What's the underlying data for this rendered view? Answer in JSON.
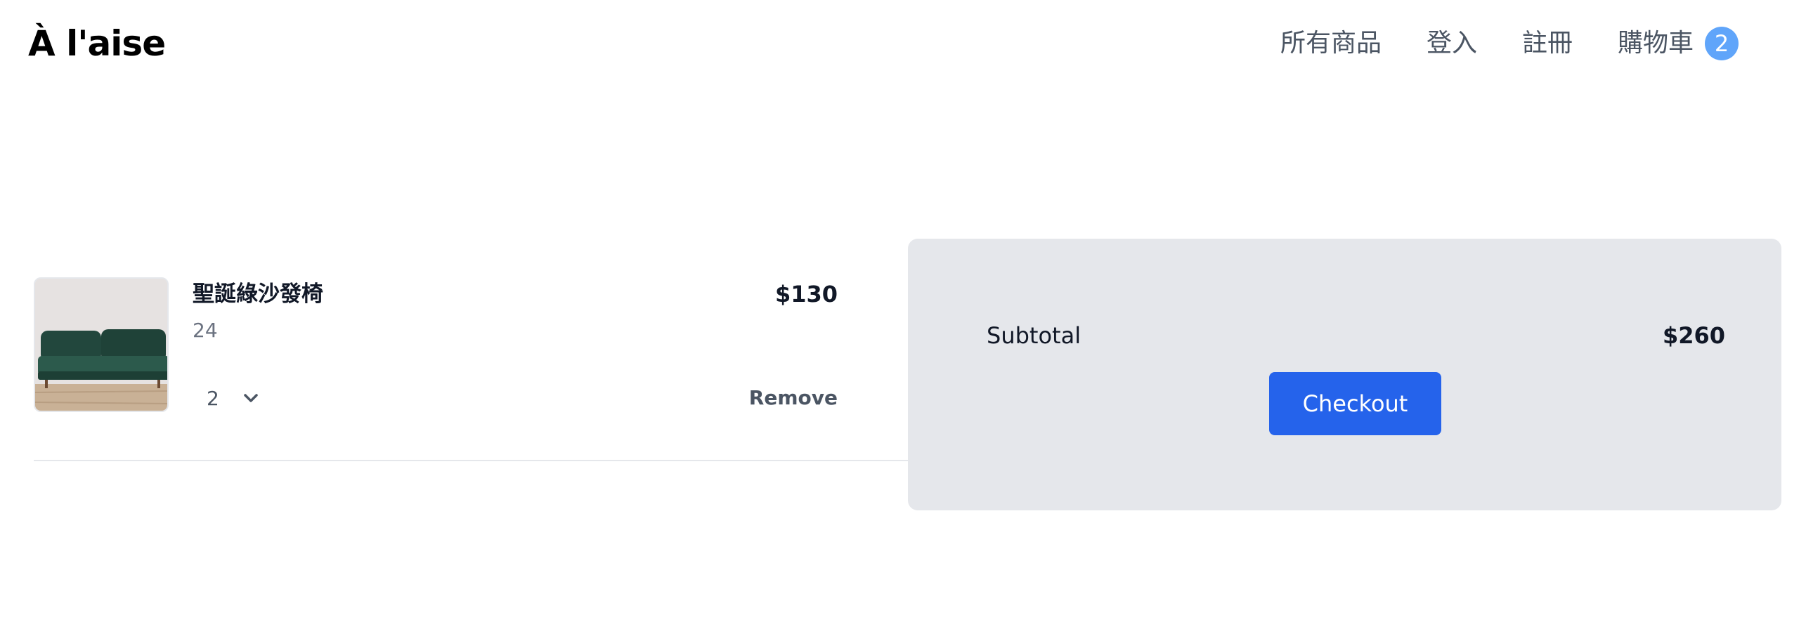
{
  "header": {
    "logo": "À l'aise",
    "nav": {
      "all_products": "所有商品",
      "login": "登入",
      "register": "註冊",
      "cart": "購物車",
      "cart_count": "2"
    }
  },
  "cart": {
    "items": [
      {
        "name": "聖誕綠沙發椅",
        "subtext": "24",
        "price": "$130",
        "quantity": "2",
        "remove_label": "Remove",
        "image_icon": "sofa-image"
      }
    ]
  },
  "summary": {
    "subtotal_label": "Subtotal",
    "subtotal_value": "$260",
    "checkout_label": "Checkout"
  },
  "colors": {
    "accent": "#2563eb",
    "badge": "#60a5fa",
    "panel": "#e5e7eb",
    "muted_text": "#4b5563"
  }
}
